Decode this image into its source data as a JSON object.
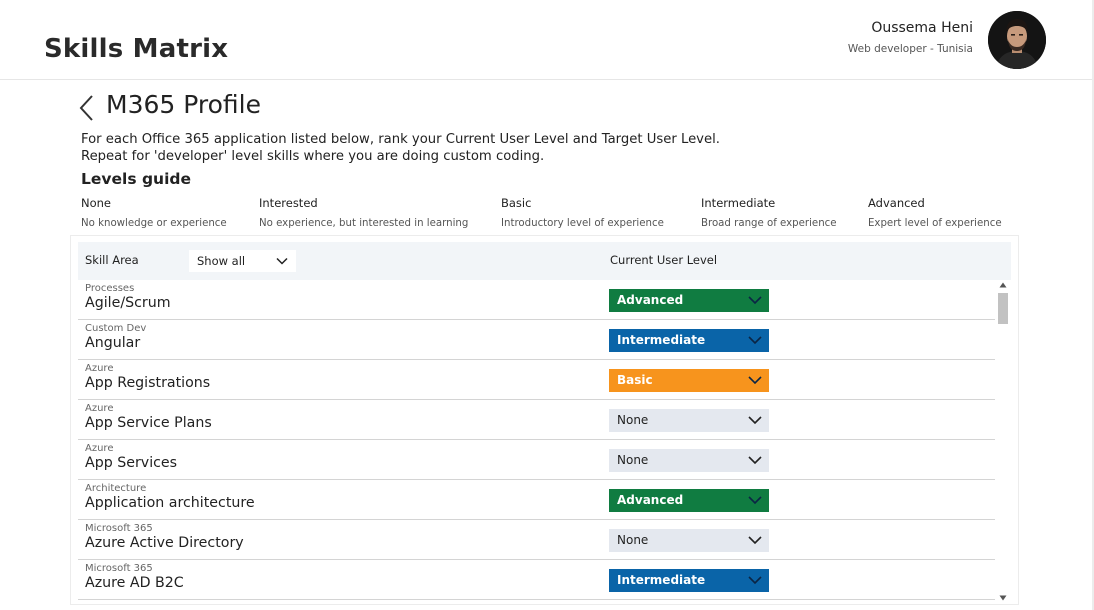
{
  "header": {
    "title": "Skills Matrix",
    "user_name": "Oussema Heni",
    "user_role": "Web developer - Tunisia"
  },
  "page": {
    "title": "M365 Profile",
    "instructions": [
      "For each Office 365 application listed below, rank your Current User Level and Target User Level.",
      "Repeat for 'developer' level skills where you are doing custom coding."
    ]
  },
  "levels_guide": {
    "heading": "Levels guide",
    "levels": [
      {
        "name": "None",
        "description": "No knowledge or experience"
      },
      {
        "name": "Interested",
        "description": "No experience, but interested in learning"
      },
      {
        "name": "Basic",
        "description": "Introductory level of experience"
      },
      {
        "name": "Intermediate",
        "description": "Broad range of experience"
      },
      {
        "name": "Advanced",
        "description": "Expert level of experience"
      }
    ]
  },
  "table": {
    "col_skill": "Skill Area",
    "filter_value": "Show all",
    "col_level": "Current User Level",
    "rows": [
      {
        "category": "Processes",
        "skill": "Agile/Scrum",
        "level": "Advanced"
      },
      {
        "category": "Custom Dev",
        "skill": "Angular",
        "level": "Intermediate"
      },
      {
        "category": "Azure",
        "skill": "App Registrations",
        "level": "Basic"
      },
      {
        "category": "Azure",
        "skill": "App Service Plans",
        "level": "None"
      },
      {
        "category": "Azure",
        "skill": "App Services",
        "level": "None"
      },
      {
        "category": "Architecture",
        "skill": "Application architecture",
        "level": "Advanced"
      },
      {
        "category": "Microsoft 365",
        "skill": "Azure Active Directory",
        "level": "None"
      },
      {
        "category": "Microsoft 365",
        "skill": "Azure AD B2C",
        "level": "Intermediate"
      }
    ]
  },
  "colors": {
    "Advanced": "#107c41",
    "Intermediate": "#0a64a8",
    "Basic": "#f7941d",
    "None": "#e4e8ef"
  }
}
